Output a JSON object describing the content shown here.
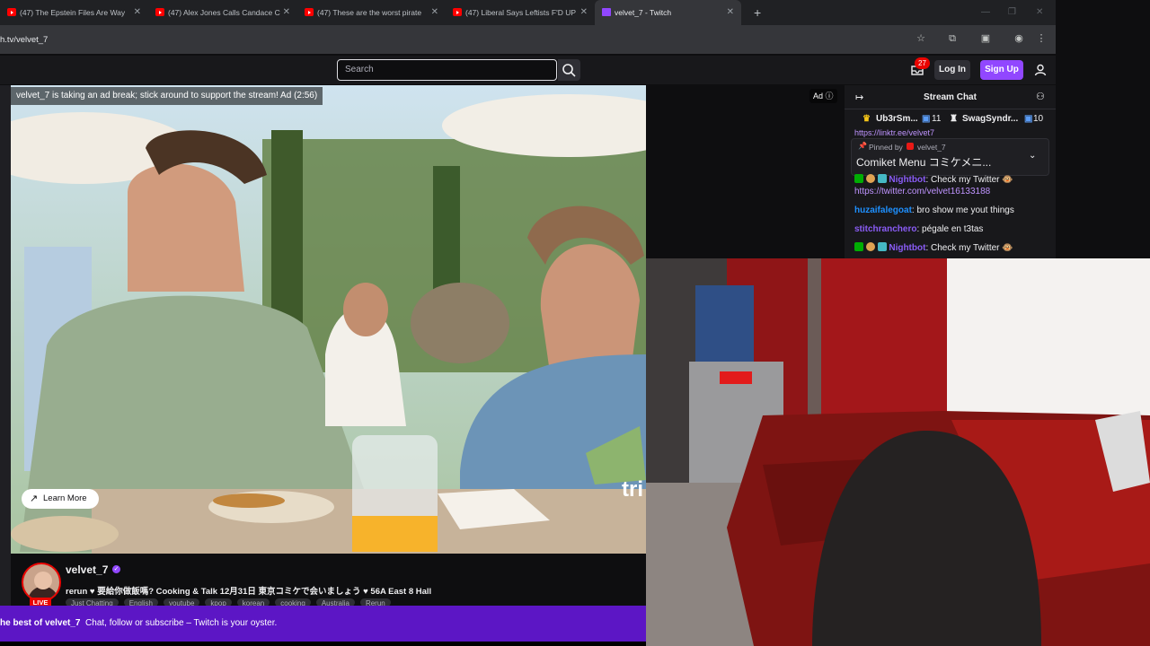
{
  "browser": {
    "tabs": [
      {
        "title": "(47) The Epstein Files Are Way",
        "active": false
      },
      {
        "title": "(47) Alex Jones Calls Candace C",
        "active": false
      },
      {
        "title": "(47) These are the worst pirate",
        "active": false
      },
      {
        "title": "(47) Liberal Says Leftists F'D UP",
        "active": false
      },
      {
        "title": "velvet_7 - Twitch",
        "active": true
      }
    ],
    "new_tab": "+",
    "url": "h.tv/velvet_7"
  },
  "twitch_nav": {
    "search_placeholder": "Search",
    "notifications_count": "27",
    "login_label": "Log In",
    "signup_label": "Sign Up"
  },
  "ad": {
    "banner": "velvet_7 is taking an ad break; stick around to support the stream! Ad (2:56)",
    "tag": "Ad",
    "learn_more": "Learn More",
    "overlay_text": "tri"
  },
  "chat": {
    "title": "Stream Chat",
    "gifters": [
      {
        "name": "Ub3rSm...",
        "count": "11"
      },
      {
        "name": "SwagSyndr...",
        "count": "10"
      }
    ],
    "link_cut": "https://linktr.ee/velvet7",
    "pinned": {
      "label": "Pinned by",
      "by": "velvet_7",
      "text": "Comiket Menu コミケメニ..."
    },
    "messages": [
      {
        "user": "Nightbot",
        "text": ": Check my Twitter",
        "color": "#8a5cf6"
      },
      {
        "user": "",
        "text": "https://twitter.com/velvet16133188",
        "color": "#bf94ff"
      },
      {
        "user": "huzaifalegoat",
        "text": ": bro show me yout things",
        "color": "#1e90ff"
      },
      {
        "user": "stitchranchero",
        "text": ": pégale en t3tas",
        "color": "#8a5cf6"
      },
      {
        "user": "Nightbot",
        "text": ": Check my Twitter",
        "color": "#8a5cf6"
      }
    ]
  },
  "channel": {
    "name": "velvet_7",
    "title": "rerun ♥ 要給你做飯嗎? Cooking & Talk 12月31日 東京コミケで会いましょう ♥ 56A East 8 Hall",
    "tags": [
      "Just Chatting",
      "English",
      "youtube",
      "kpop",
      "korean",
      "cooking",
      "Australia",
      "Rerun"
    ],
    "live": "LIVE"
  },
  "promo": {
    "bold": "he best of velvet_7",
    "text": "Chat, follow or subscribe – Twitch is your oyster."
  },
  "colors": {
    "twitch_purple": "#9147ff",
    "promo_purple": "#5c16c5",
    "live_red": "#eb0400"
  }
}
